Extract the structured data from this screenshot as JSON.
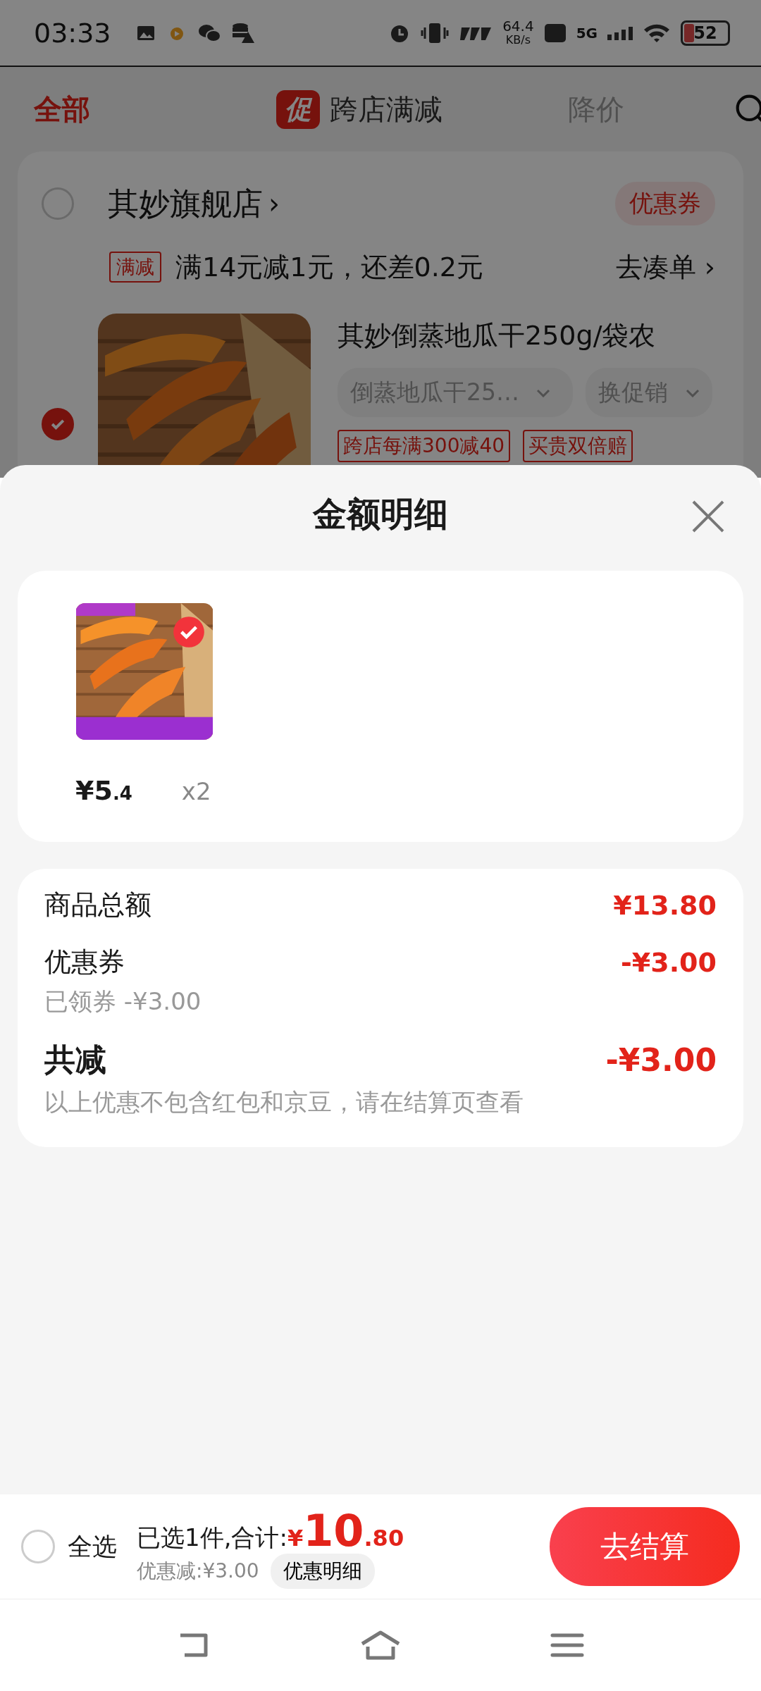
{
  "status_bar": {
    "time": "03:33",
    "network_speed": "64.4",
    "network_speed_unit": "KB/s",
    "network_type": "5G",
    "battery": "52"
  },
  "tabs": [
    {
      "label": "全部",
      "selected": true
    },
    {
      "label": "跨店满减",
      "selected": false,
      "badge": "促"
    },
    {
      "label": "降价",
      "selected": false
    }
  ],
  "store": {
    "name": "其妙旗舰店",
    "chevron": "›",
    "selected": false,
    "coupon_label": "优惠券",
    "promo": {
      "tag": "满减",
      "text": "满14元减1元，还差0.2元",
      "action": "去凑单",
      "chevron": "›"
    },
    "product": {
      "selected": true,
      "title": "其妙倒蒸地瓜干250g/袋农",
      "spec": "倒蒸地瓜干25…",
      "promo_select": "换促销",
      "tags": [
        "跨店每满300减40",
        "买贵双倍赔"
      ]
    }
  },
  "sheet": {
    "title": "金额明细",
    "items": [
      {
        "selected": true,
        "price_symbol": "¥",
        "price_int": "5",
        "price_dec": ".4",
        "quantity": "x2"
      }
    ],
    "breakdown": [
      {
        "kind": "line",
        "label": "商品总额",
        "amount": "¥13.80"
      },
      {
        "kind": "line",
        "label": "优惠券",
        "amount": "-¥3.00",
        "note": "已领券 -¥3.00"
      },
      {
        "kind": "total",
        "label": "共减",
        "amount": "-¥3.00",
        "note": "以上优惠不包含红包和京豆，请在结算页查看"
      }
    ]
  },
  "bottom_bar": {
    "select_all": {
      "label": "全选",
      "checked": false
    },
    "summary": "已选1件,合计:",
    "currency": "¥",
    "total_int": "10",
    "total_dec": ".80",
    "discount": "优惠减:¥3.00",
    "detail_button": "优惠明细",
    "checkout_button": "去结算"
  }
}
